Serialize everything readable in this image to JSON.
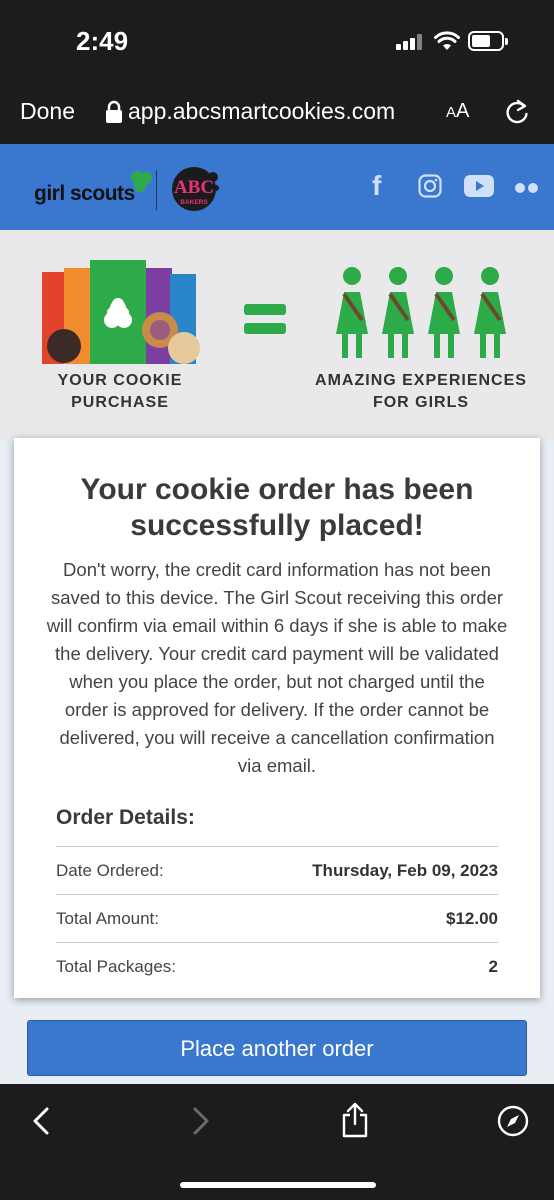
{
  "status_bar": {
    "time": "2:49"
  },
  "browser": {
    "done_label": "Done",
    "url": "app.abcsmartcookies.com",
    "text_size_label_small": "A",
    "text_size_label_large": "A"
  },
  "site_header": {
    "brand": "girl scouts",
    "partner_logo_text": "ABC",
    "partner_logo_subtext": "BAKERS",
    "brand_color": "#3a78cf"
  },
  "hero": {
    "left_caption": [
      "YOUR COOKIE",
      "PURCHASE"
    ],
    "right_caption": [
      "AMAZING EXPERIENCES",
      "FOR GIRLS"
    ],
    "accent_green": "#2eab49"
  },
  "confirmation": {
    "title_line1": "Your cookie order has been",
    "title_line2": "successfully placed!",
    "message": "Don't worry, the credit card information has not been saved to this device. The Girl Scout receiving this order will confirm via email within 6 days if she is able to make the delivery. Your credit card payment will be validated when you place the order, but not charged until the order is approved for delivery. If the order cannot be delivered, you will receive a cancellation confirmation via email."
  },
  "order_details": {
    "heading": "Order Details:",
    "rows": [
      {
        "label": "Date Ordered:",
        "value": "Thursday, Feb 09, 2023"
      },
      {
        "label": "Total Amount:",
        "value": "$12.00"
      },
      {
        "label": "Total Packages:",
        "value": "2"
      }
    ]
  },
  "actions": {
    "place_another_order": "Place another order"
  }
}
